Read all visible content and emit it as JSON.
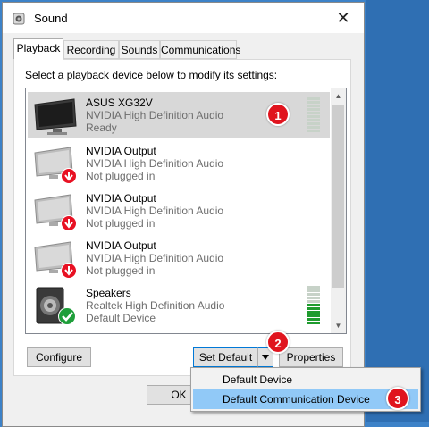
{
  "window": {
    "title": "Sound",
    "close_glyph": "✕"
  },
  "tabs": [
    {
      "label": "Playback",
      "active": true
    },
    {
      "label": "Recording"
    },
    {
      "label": "Sounds"
    },
    {
      "label": "Communications"
    }
  ],
  "instruction": "Select a playback device below to modify its settings:",
  "devices": [
    {
      "name": "ASUS XG32V",
      "driver": "NVIDIA High Definition Audio",
      "status": "Ready",
      "icon": "monitor-icon",
      "selected": true
    },
    {
      "name": "NVIDIA Output",
      "driver": "NVIDIA High Definition Audio",
      "status": "Not plugged in",
      "icon": "monitor-unplugged-icon"
    },
    {
      "name": "NVIDIA Output",
      "driver": "NVIDIA High Definition Audio",
      "status": "Not plugged in",
      "icon": "monitor-unplugged-icon"
    },
    {
      "name": "NVIDIA Output",
      "driver": "NVIDIA High Definition Audio",
      "status": "Not plugged in",
      "icon": "monitor-unplugged-icon"
    },
    {
      "name": "Speakers",
      "driver": "Realtek High Definition Audio",
      "status": "Default Device",
      "icon": "speaker-default-icon"
    }
  ],
  "buttons": {
    "configure": "Configure",
    "set_default": "Set Default",
    "properties": "Properties",
    "ok": "OK"
  },
  "dropdown_menu": [
    {
      "label": "Default Device"
    },
    {
      "label": "Default Communication Device",
      "highlighted": true
    }
  ],
  "annotations": [
    "1",
    "2",
    "3"
  ],
  "colors": {
    "badge": "#e0141e",
    "menu_highlight": "#91c9f7",
    "meter_active": "#1f9b2e",
    "focus": "#0078d7"
  }
}
